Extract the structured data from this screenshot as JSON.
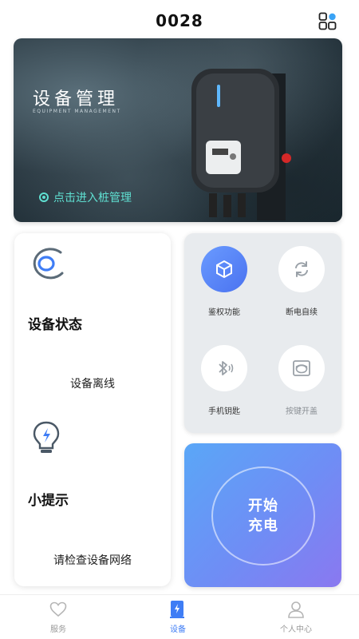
{
  "header": {
    "title": "0028",
    "grid_icon": "grid-apps-icon"
  },
  "banner": {
    "title": "设备管理",
    "subtitle": "EQUIPMENT MANAGEMENT",
    "link_label": "点击进入桩管理"
  },
  "status_card": {
    "title": "设备状态",
    "value": "设备离线",
    "tip_title": "小提示",
    "tip_value": "请检查设备网络"
  },
  "functions": [
    {
      "label": "鉴权功能",
      "icon": "cube-icon",
      "active": true
    },
    {
      "label": "断电自续",
      "icon": "refresh-icon",
      "active": false
    },
    {
      "label": "手机钥匙",
      "icon": "bluetooth-icon",
      "active": false
    },
    {
      "label": "按键开盖",
      "icon": "button-icon",
      "active": false
    }
  ],
  "charge_button": {
    "line1": "开始",
    "line2": "充电"
  },
  "nav": [
    {
      "label": "服务",
      "icon": "heart-icon",
      "active": false
    },
    {
      "label": "设备",
      "icon": "charger-icon",
      "active": true
    },
    {
      "label": "个人中心",
      "icon": "user-icon",
      "active": false
    }
  ],
  "colors": {
    "accent": "#3f7df5",
    "teal": "#5fe0d2",
    "charge_start": "#5aa7f7",
    "charge_end": "#8a78f0"
  }
}
